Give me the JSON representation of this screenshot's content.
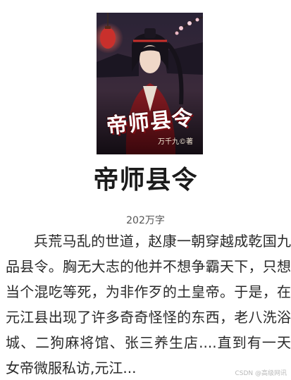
{
  "book": {
    "cover": {
      "title": "帝师县令",
      "author_line": "万千九©著"
    },
    "title": "帝师县令",
    "word_count": "202万字",
    "synopsis": "兵荒马乱的世道，赵康一朝穿越成乾国九品县令。胸无大志的他并不想争霸天下，只想当个混吃等死，为非作歹的土皇帝。于是，在元江县出现了许多奇奇怪怪的东西，老八洗浴城、二狗麻将馆、张三养生店....直到有一天女帝微服私访,元江..."
  },
  "watermark": "CSDN @高级网讯"
}
